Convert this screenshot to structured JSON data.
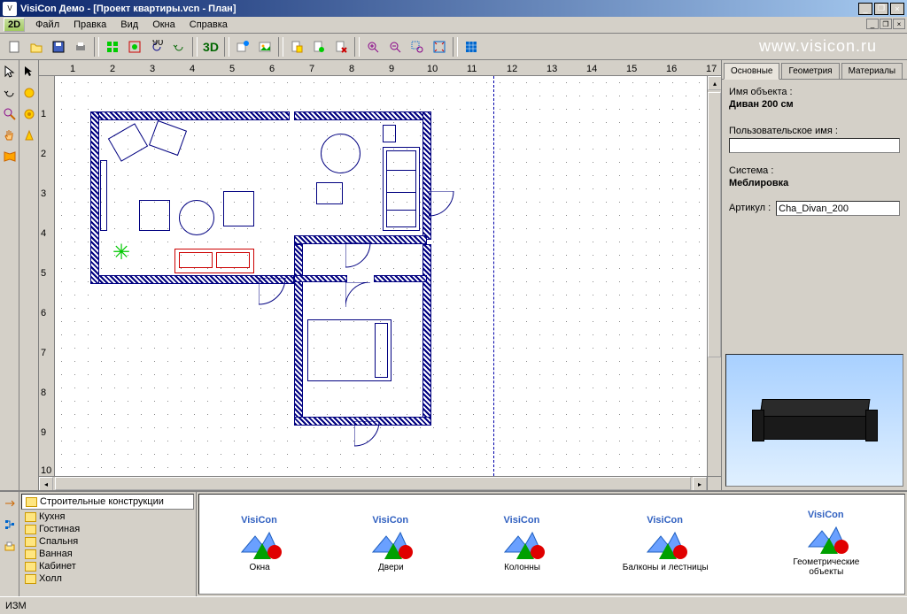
{
  "title": "VisiCon Демо - [Проект квартиры.vcn - План]",
  "menubar_2d": "2D",
  "menu": [
    "Файл",
    "Правка",
    "Вид",
    "Окна",
    "Справка"
  ],
  "toolbar3d": "3D",
  "watermark": "www.visicon.ru",
  "ruler_h": [
    "1",
    "2",
    "3",
    "4",
    "5",
    "6",
    "7",
    "8",
    "9",
    "10",
    "11",
    "12",
    "13",
    "14",
    "15",
    "16",
    "17"
  ],
  "ruler_v": [
    "1",
    "2",
    "3",
    "4",
    "5",
    "6",
    "7",
    "8",
    "9",
    "10"
  ],
  "props": {
    "tabs": [
      "Основные",
      "Геометрия",
      "Материалы"
    ],
    "obj_name_label": "Имя объекта :",
    "obj_name_value": "Диван 200 см",
    "user_name_label": "Пользовательское имя :",
    "user_name_value": "",
    "system_label": "Система :",
    "system_value": "Меблировка",
    "article_label": "Артикул :",
    "article_value": "Cha_Divan_200"
  },
  "tree": {
    "header": "Строительные конструкции",
    "items": [
      "Кухня",
      "Гостиная",
      "Спальня",
      "Ванная",
      "Кабинет",
      "Холл"
    ]
  },
  "catalog_brand": "VisiCon",
  "catalog": [
    "Окна",
    "Двери",
    "Колонны",
    "Балконы и лестницы",
    "Геометрические объекты"
  ],
  "status": "ИЗМ"
}
